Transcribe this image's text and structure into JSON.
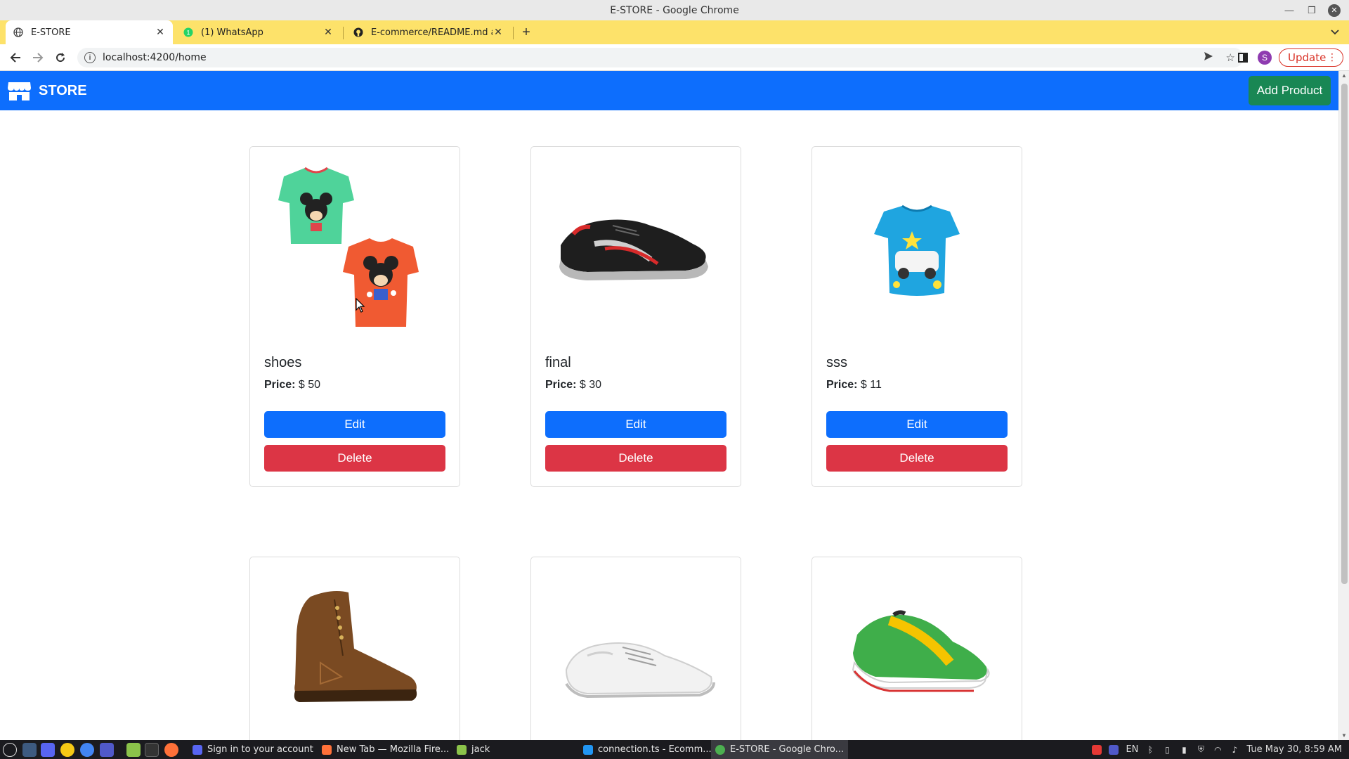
{
  "window": {
    "title": "E-STORE - Google Chrome"
  },
  "tabs": [
    {
      "label": "E-STORE",
      "active": true
    },
    {
      "label": "(1) WhatsApp",
      "active": false
    },
    {
      "label": "E-commerce/README.md at r",
      "active": false
    }
  ],
  "address": {
    "url": "localhost:4200/home",
    "update_label": "Update",
    "profile_initial": "S"
  },
  "app": {
    "brand": "STORE",
    "add_product_label": "Add Product",
    "price_label": "Price:",
    "edit_label": "Edit",
    "delete_label": "Delete"
  },
  "products": [
    {
      "name": "shoes",
      "price": "$ 50",
      "image": "mickey-tshirts"
    },
    {
      "name": "final",
      "price": "$ 30",
      "image": "black-sneaker"
    },
    {
      "name": "sss",
      "price": "$ 11",
      "image": "blue-tshirt"
    },
    {
      "name": "",
      "price": "",
      "image": "brown-boot"
    },
    {
      "name": "",
      "price": "",
      "image": "white-shoe"
    },
    {
      "name": "",
      "price": "",
      "image": "green-sneaker"
    }
  ],
  "taskbar": {
    "tasks": [
      {
        "label": "Sign in to your account",
        "color": "#5865f2"
      },
      {
        "label": "New Tab — Mozilla Fire...",
        "color": "#ff7139"
      },
      {
        "label": "jack",
        "color": "#8bc34a"
      },
      {
        "label": "connection.ts - Ecomm...",
        "color": "#2196f3"
      },
      {
        "label": "E-STORE - Google Chro...",
        "color": "#4caf50"
      }
    ],
    "lang": "EN",
    "clock": "Tue May 30, 8:59 AM"
  },
  "colors": {
    "primary": "#0d6efd",
    "success": "#198754",
    "danger": "#dc3545",
    "tabstrip": "#fde26a"
  }
}
